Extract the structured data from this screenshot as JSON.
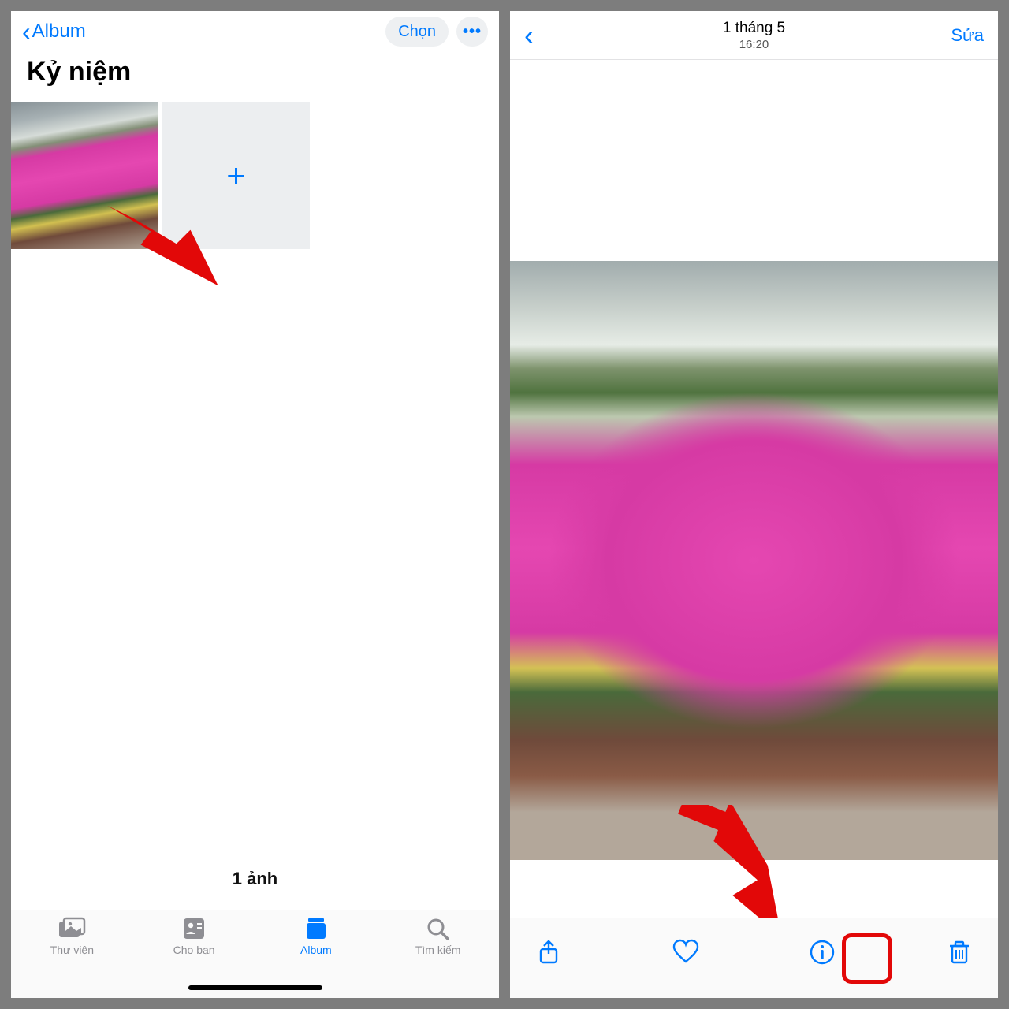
{
  "left": {
    "back_label": "Album",
    "select_label": "Chọn",
    "title": "Kỷ niệm",
    "count_label": "1 ảnh",
    "tabs": [
      {
        "label": "Thư viện",
        "icon": "library-icon"
      },
      {
        "label": "Cho bạn",
        "icon": "for-you-icon"
      },
      {
        "label": "Album",
        "icon": "album-icon"
      },
      {
        "label": "Tìm kiếm",
        "icon": "search-icon"
      }
    ],
    "add_icon": "+",
    "more_icon": "•••"
  },
  "right": {
    "date": "1 tháng 5",
    "time": "16:20",
    "edit_label": "Sửa",
    "toolbar_icons": [
      "share-icon",
      "heart-icon",
      "info-icon",
      "trash-icon"
    ]
  },
  "colors": {
    "accent": "#007aff",
    "annotation": "#e20808"
  }
}
